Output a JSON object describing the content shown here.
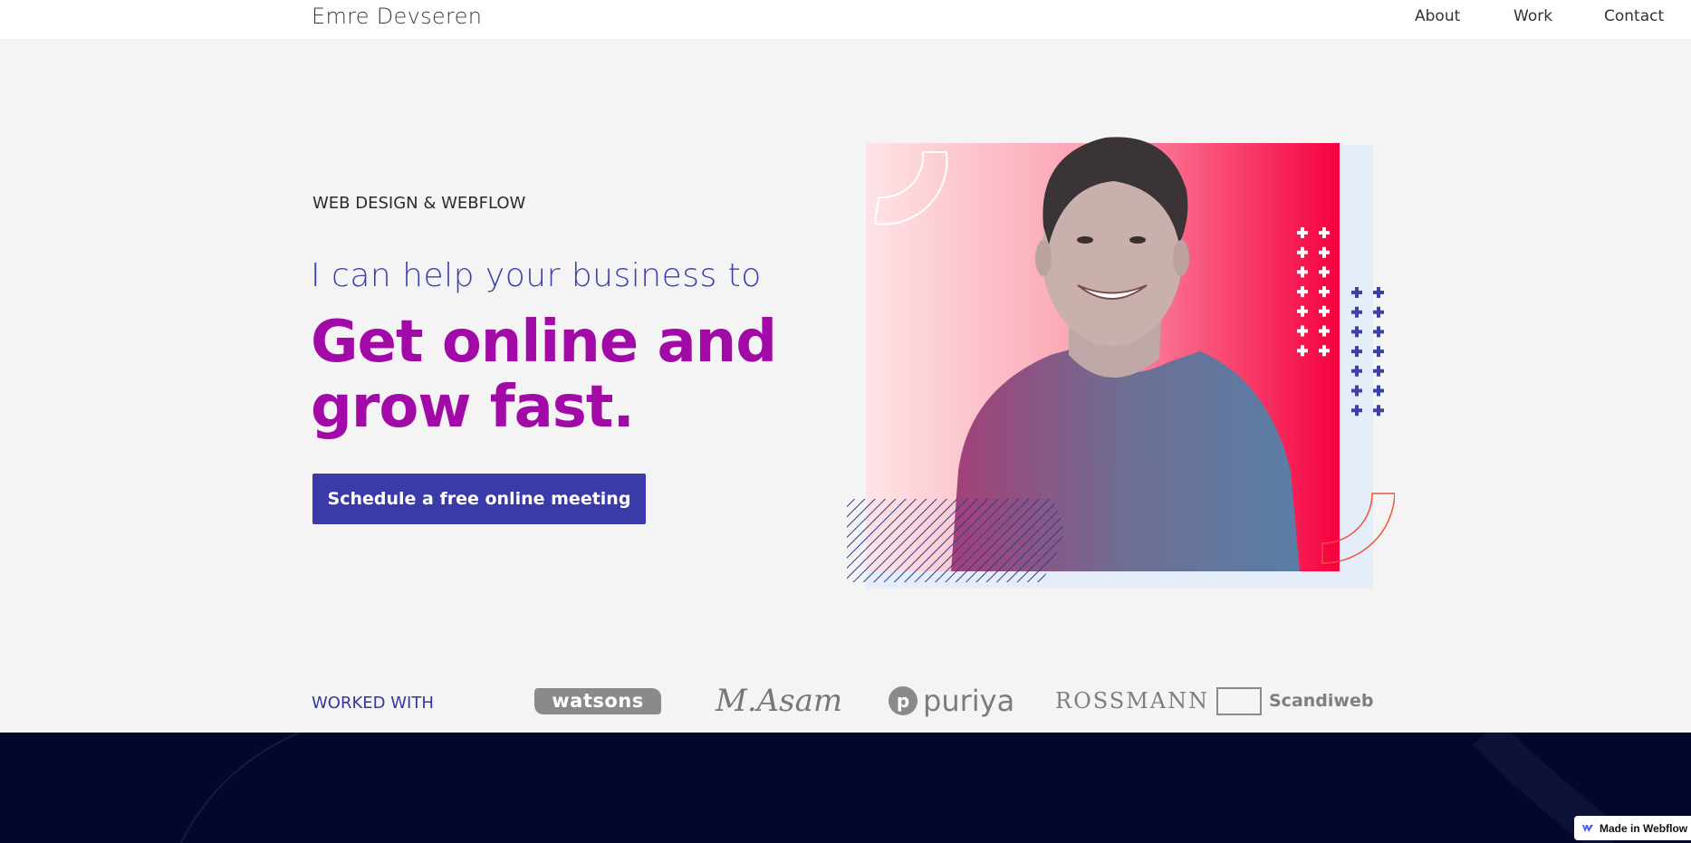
{
  "header": {
    "brand": "Emre Devseren",
    "nav": [
      "About",
      "Work",
      "Contact"
    ]
  },
  "hero": {
    "eyebrow": "WEB DESIGN & WEBFLOW",
    "lead": "I can help your business to",
    "headline_line1": "Get online and",
    "headline_line2": "grow fast.",
    "cta_label": "Schedule a free online meeting"
  },
  "clients": {
    "label": "WORKED WITH",
    "logos": [
      "watsons",
      "M.Asam",
      "puriya",
      "ROSSMANN",
      "Scandiweb"
    ]
  },
  "badge": {
    "label": "Made in Webflow"
  },
  "colors": {
    "accent_blue": "#3a3aa8",
    "headline_purple": "#a10aa7",
    "hero_pink": "#f5003f",
    "dark_band": "#05072a",
    "page_bg": "#f4f4f4"
  },
  "icons": [
    "plus-pattern-icon",
    "hatch-pattern-icon",
    "arc-outline-icon",
    "webflow-logo-icon",
    "portrait-photo"
  ]
}
